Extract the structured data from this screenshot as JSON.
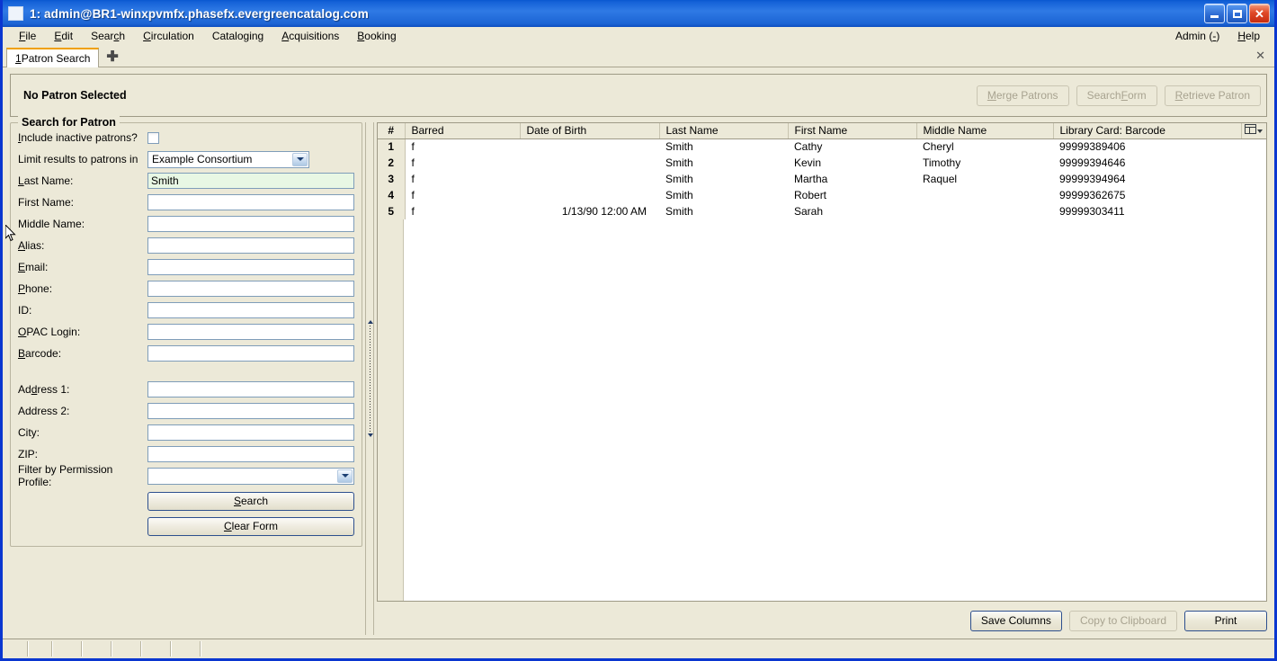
{
  "window": {
    "title": "1: admin@BR1-winxpvmfx.phasefx.evergreencatalog.com",
    "minimize_label": "",
    "maximize_label": "",
    "close_label": "✕"
  },
  "menubar": {
    "items": [
      {
        "pre": "",
        "accel": "F",
        "post": "ile"
      },
      {
        "pre": "",
        "accel": "E",
        "post": "dit"
      },
      {
        "pre": "Sear",
        "accel": "c",
        "post": "h"
      },
      {
        "pre": "",
        "accel": "C",
        "post": "irculation"
      },
      {
        "pre": "Catalo",
        "accel": "g",
        "post": "ing"
      },
      {
        "pre": "",
        "accel": "A",
        "post": "cquisitions"
      },
      {
        "pre": "",
        "accel": "B",
        "post": "ooking"
      }
    ],
    "right": [
      {
        "pre": "Admin (",
        "accel": "-",
        "post": ")"
      },
      {
        "pre": "",
        "accel": "H",
        "post": "elp"
      }
    ]
  },
  "tabs": {
    "active": {
      "accel": "1",
      "label": " Patron Search"
    },
    "new_tab_glyph": "✚",
    "close_glyph": "✕"
  },
  "patron_bar": {
    "title": "No Patron Selected",
    "buttons": [
      {
        "pre": "",
        "accel": "M",
        "post": "erge Patrons",
        "disabled": true,
        "name": "merge-patrons-button"
      },
      {
        "pre": "Search ",
        "accel": "F",
        "post": "orm",
        "disabled": true,
        "name": "search-form-button"
      },
      {
        "pre": "",
        "accel": "R",
        "post": "etrieve Patron",
        "disabled": true,
        "name": "retrieve-patron-button"
      }
    ]
  },
  "search_panel": {
    "legend": "Search for Patron",
    "inactive": {
      "pre": "",
      "accel": "I",
      "post": "nclude inactive patrons?",
      "checked": false
    },
    "limit": {
      "label": "Limit results to patrons in",
      "value": "Example Consortium"
    },
    "fields": [
      {
        "pre": "",
        "accel": "L",
        "post": "ast Name:",
        "value": "Smith",
        "active": true,
        "name": "last-name-input"
      },
      {
        "pre": "First Name:",
        "accel": "",
        "post": "",
        "value": "",
        "active": false,
        "name": "first-name-input"
      },
      {
        "pre": "Middle Name:",
        "accel": "",
        "post": "",
        "value": "",
        "active": false,
        "name": "middle-name-input"
      },
      {
        "pre": "",
        "accel": "A",
        "post": "lias:",
        "value": "",
        "active": false,
        "name": "alias-input"
      },
      {
        "pre": "",
        "accel": "E",
        "post": "mail:",
        "value": "",
        "active": false,
        "name": "email-input"
      },
      {
        "pre": "",
        "accel": "P",
        "post": "hone:",
        "value": "",
        "active": false,
        "name": "phone-input"
      },
      {
        "pre": "ID:",
        "accel": "",
        "post": "",
        "value": "",
        "active": false,
        "name": "id-input"
      },
      {
        "pre": "",
        "accel": "O",
        "post": "PAC Login:",
        "value": "",
        "active": false,
        "name": "opac-login-input"
      },
      {
        "pre": "",
        "accel": "B",
        "post": "arcode:",
        "value": "",
        "active": false,
        "name": "barcode-input"
      }
    ],
    "address_fields": [
      {
        "pre": "Ad",
        "accel": "d",
        "post": "ress 1:",
        "value": "",
        "name": "address1-input"
      },
      {
        "pre": "Address 2:",
        "accel": "",
        "post": "",
        "value": "",
        "name": "address2-input"
      },
      {
        "pre": "City:",
        "accel": "",
        "post": "",
        "value": "",
        "name": "city-input"
      },
      {
        "pre": "ZIP:",
        "accel": "",
        "post": "",
        "value": "",
        "name": "zip-input"
      }
    ],
    "permission_profile": {
      "label": "Filter by Permission Profile:",
      "value": ""
    },
    "search_button": {
      "pre": "",
      "accel": "S",
      "post": "earch"
    },
    "clear_button": {
      "pre": "",
      "accel": "C",
      "post": "lear Form"
    }
  },
  "results": {
    "columns": [
      "#",
      "Barred",
      "Date of Birth",
      "Last Name",
      "First Name",
      "Middle Name",
      "Library Card: Barcode"
    ],
    "rows": [
      {
        "num": "1",
        "barred": "f",
        "dob": "",
        "last": "Smith",
        "first": "Cathy",
        "middle": "Cheryl",
        "barcode": "99999389406"
      },
      {
        "num": "2",
        "barred": "f",
        "dob": "",
        "last": "Smith",
        "first": "Kevin",
        "middle": "Timothy",
        "barcode": "99999394646"
      },
      {
        "num": "3",
        "barred": "f",
        "dob": "",
        "last": "Smith",
        "first": "Martha",
        "middle": "Raquel",
        "barcode": "99999394964"
      },
      {
        "num": "4",
        "barred": "f",
        "dob": "",
        "last": "Smith",
        "first": "Robert",
        "middle": "",
        "barcode": "99999362675"
      },
      {
        "num": "5",
        "barred": "f",
        "dob": "1/13/90 12:00 AM",
        "last": "Smith",
        "first": "Sarah",
        "middle": "",
        "barcode": "99999303411"
      }
    ],
    "footer_buttons": [
      {
        "label": "Save Columns",
        "disabled": false,
        "name": "save-columns-button"
      },
      {
        "label": "Copy to Clipboard",
        "disabled": true,
        "name": "copy-to-clipboard-button"
      },
      {
        "label": "Print",
        "disabled": false,
        "name": "print-button"
      }
    ]
  },
  "colors": {
    "titlebar_blue": "#1562d8",
    "window_border": "#0a36d0",
    "face": "#ece9d8",
    "active_field": "#e8f7e4",
    "tab_accent": "#f0a000"
  }
}
